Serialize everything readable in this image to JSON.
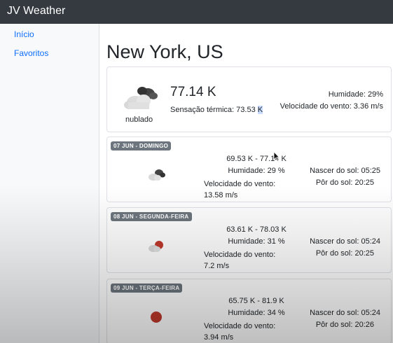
{
  "app": {
    "brand": "JV Weather"
  },
  "sidebar": {
    "items": [
      {
        "label": "Início"
      },
      {
        "label": "Favoritos"
      }
    ]
  },
  "main": {
    "city": "New York, US",
    "current": {
      "icon": "cloudy-icon",
      "description": "nublado",
      "temperature": "77.14 K",
      "feels_like_label": "Sensação térmica: 73.53 ",
      "feels_like_selected": "K",
      "humidity": "Humidade: 29%",
      "wind": "Velocidade do vento: 3.36 m/s"
    },
    "forecast": [
      {
        "date": "07 JUN - DOMINGO",
        "icon": "broken-clouds-icon",
        "range": "69.53 K - 77.14 K",
        "humidity": "Humidade: 29 %",
        "wind": "Velocidade do vento: 13.58 m/s",
        "sunrise": "Nascer do sol: 05:25",
        "sunset": "Pôr do sol: 20:25"
      },
      {
        "date": "08 JUN - SEGUNDA-FEIRA",
        "icon": "few-clouds-icon",
        "range": "63.61 K - 78.03 K",
        "humidity": "Humidade: 31 %",
        "wind": "Velocidade do vento: 7.2 m/s",
        "sunrise": "Nascer do sol: 05:24",
        "sunset": "Pôr do sol: 20:25"
      },
      {
        "date": "09 JUN - TERÇA-FEIRA",
        "icon": "clear-sky-icon",
        "range": "65.75 K - 81.9 K",
        "humidity": "Humidade: 34 %",
        "wind": "Velocidade do vento: 3.94 m/s",
        "sunrise": "Nascer do sol: 05:24",
        "sunset": "Pôr do sol: 20:26"
      }
    ]
  },
  "colors": {
    "navbar": "#343a40",
    "link": "#0d6efd",
    "badge": "#6c757d",
    "sun": "#c0392b"
  }
}
